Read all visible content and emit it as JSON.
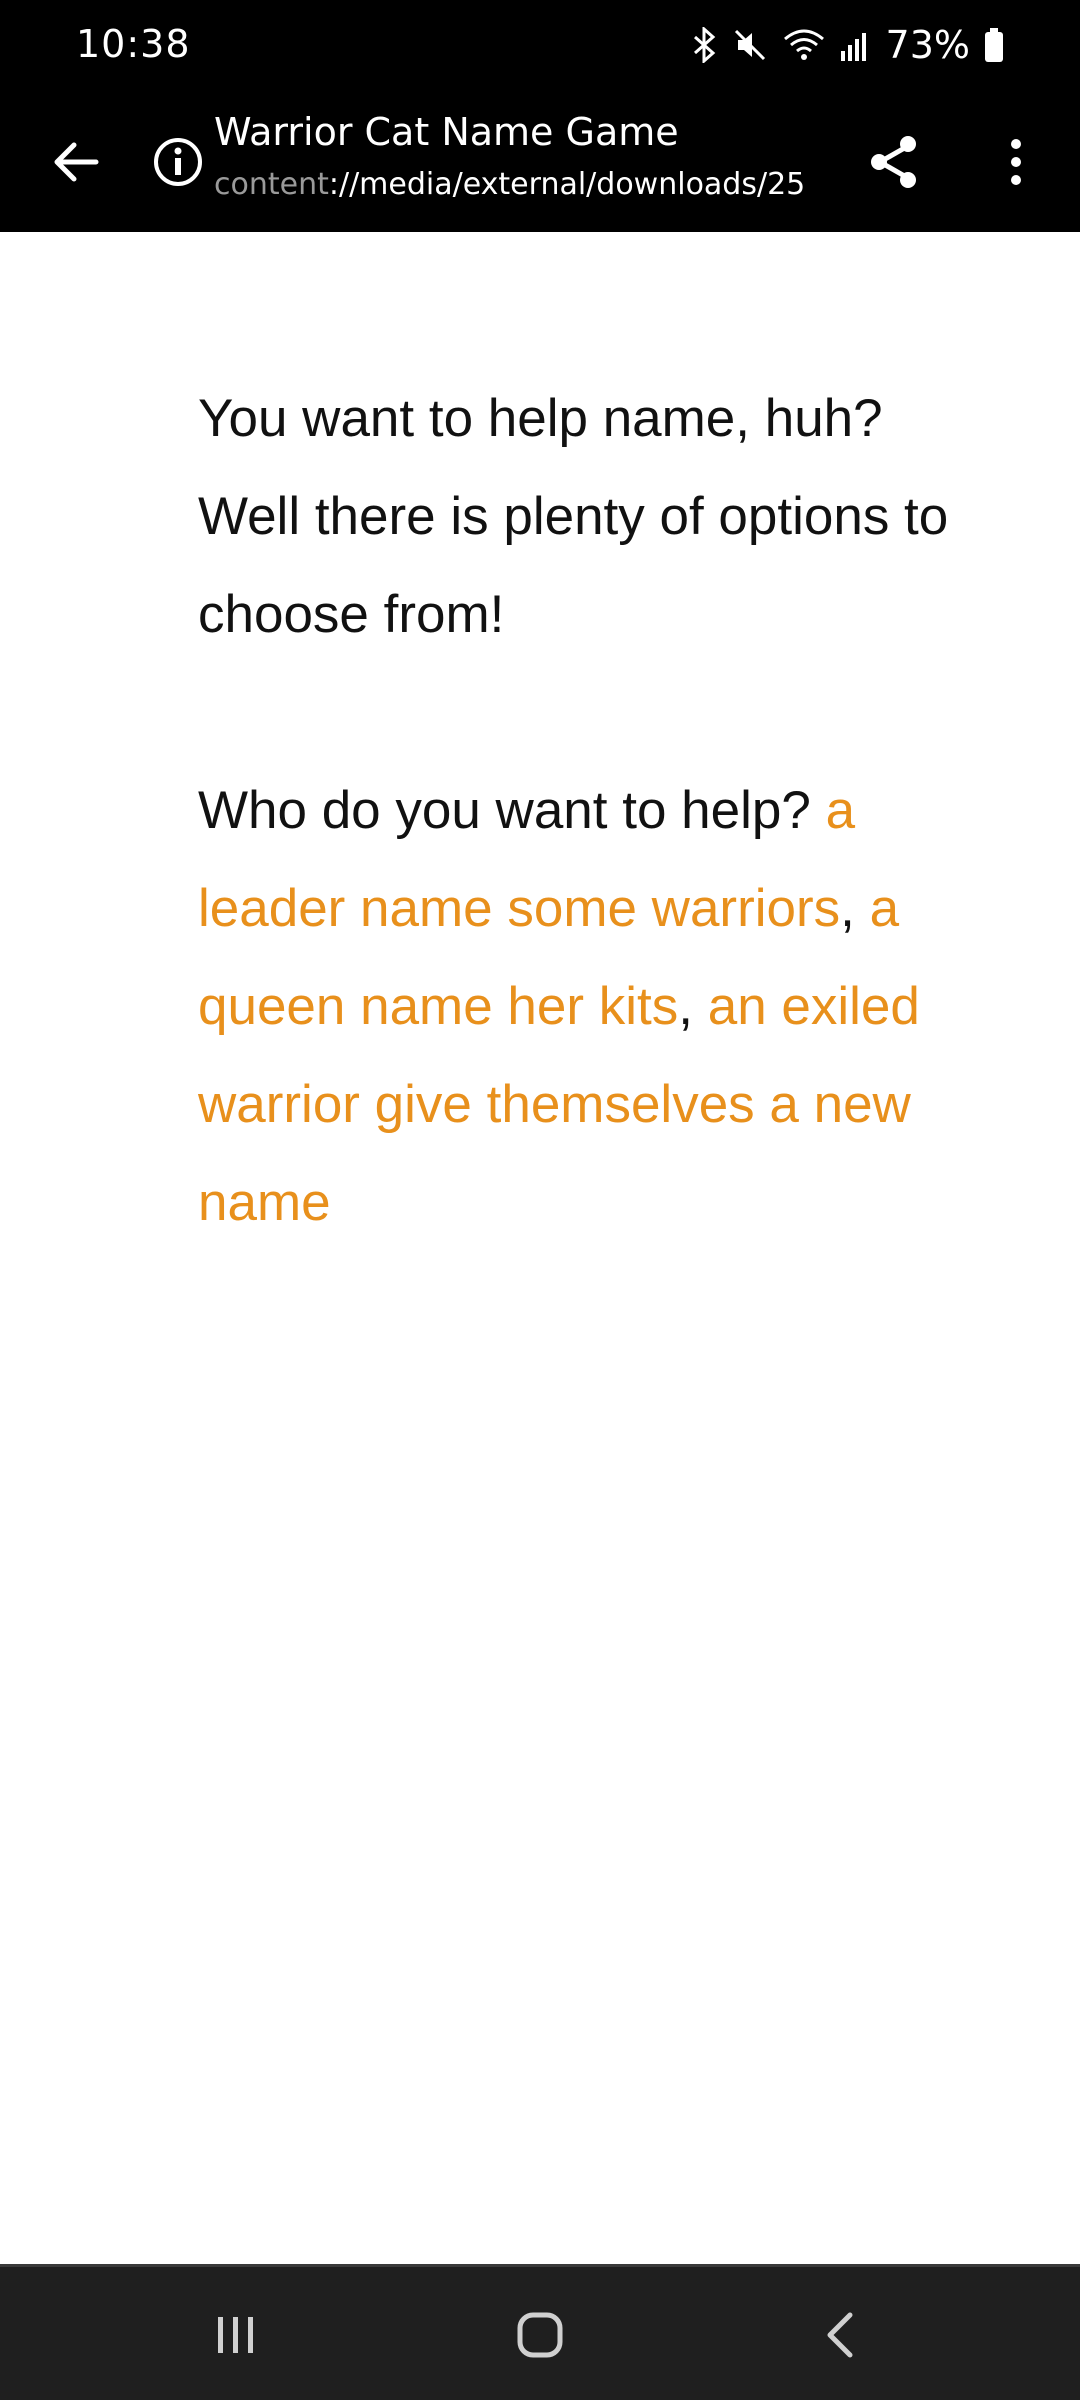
{
  "status_bar": {
    "time": "10:38",
    "battery_percent": "73%",
    "icons": [
      "bluetooth-icon",
      "mute-icon",
      "wifi-icon",
      "signal-icon",
      "battery-icon"
    ]
  },
  "app_bar": {
    "title": "Warrior Cat Name Game",
    "url_scheme": "content",
    "url_rest": "://media/external/downloads/25",
    "icons": [
      "back-arrow-icon",
      "info-icon",
      "share-icon",
      "more-vert-icon"
    ]
  },
  "story": {
    "paragraph1": "You want to help name, huh? Well there is plenty of options to choose from!",
    "prompt": "Who do you want to help?",
    "choices": [
      "a leader name some warriors",
      "a queen name her kits",
      "an exiled warrior give themselves a new name"
    ],
    "separator": ","
  },
  "colors": {
    "link": "#e8901c",
    "bars": "#000000",
    "nav": "#1f1f1f"
  },
  "nav_bar": {
    "icons": [
      "recents-icon",
      "home-icon",
      "back-icon"
    ]
  }
}
